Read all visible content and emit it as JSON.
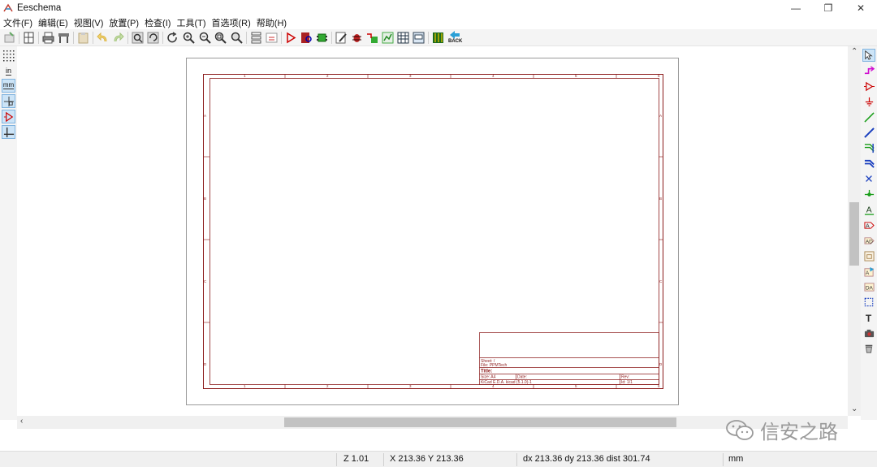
{
  "window": {
    "title": "Eeschema",
    "minimize": "—",
    "restore": "❐",
    "close": "✕"
  },
  "menu": [
    {
      "label": "文件(F)"
    },
    {
      "label": "编辑(E)"
    },
    {
      "label": "视图(V)"
    },
    {
      "label": "放置(P)"
    },
    {
      "label": "检查(I)"
    },
    {
      "label": "工具(T)"
    },
    {
      "label": "首选项(R)"
    },
    {
      "label": "帮助(H)"
    }
  ],
  "toolbar": {
    "back_label": "BACK"
  },
  "left_toolbar": {
    "units_in": "in",
    "units_mm": "mm"
  },
  "sheet": {
    "col_numbers": [
      "1",
      "2",
      "3",
      "4",
      "5",
      "6"
    ],
    "row_letters": [
      "A",
      "B",
      "C",
      "D"
    ],
    "title_block": {
      "sheet": "Sheet: /",
      "file": "File: PPMTech",
      "title": "Title:",
      "size": "Size: A4",
      "date": "Date:",
      "rev": "Rev:",
      "kicad": "KiCad E.D.A.  kicad (5.1.0)-1",
      "id": "Id: 1/1"
    }
  },
  "status": {
    "zoom": "Z 1.01",
    "xy": "X 213.36  Y 213.36",
    "delta": "dx 213.36  dy 213.36  dist 301.74",
    "units": "mm"
  },
  "watermark": {
    "text": "信安之路"
  },
  "colors": {
    "sheet_border": "#8b1a1a",
    "toolbar_bg": "#f4f4f4",
    "active_tool": "#cce4f7"
  }
}
